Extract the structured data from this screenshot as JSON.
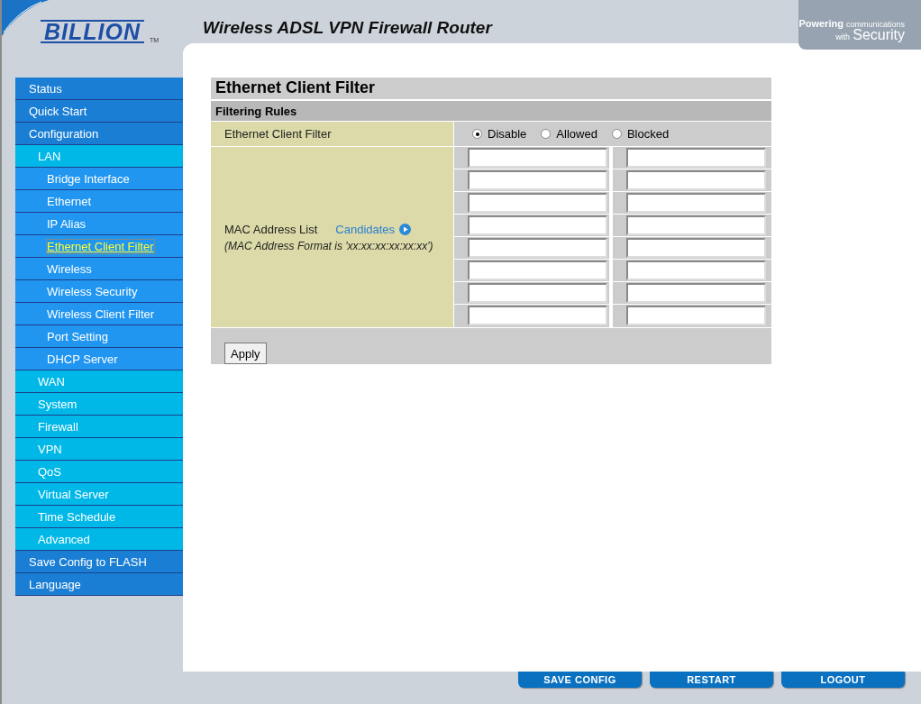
{
  "header": {
    "logo": "BILLION",
    "trademark": "TM",
    "title": "Wireless ADSL VPN Firewall Router",
    "tagline": {
      "lead": "Powering",
      "rest": "communications",
      "line2_small": "with",
      "line2_big": "Security"
    }
  },
  "menu": [
    {
      "label": "Status",
      "selected": false
    },
    {
      "label": "Quick Start",
      "selected": false
    },
    {
      "label": "Configuration",
      "selected": false,
      "children": [
        {
          "label": "LAN",
          "selected": false,
          "children": [
            {
              "label": "Bridge Interface",
              "selected": false
            },
            {
              "label": "Ethernet",
              "selected": false
            },
            {
              "label": "IP Alias",
              "selected": false
            },
            {
              "label": "Ethernet Client Filter",
              "selected": true
            },
            {
              "label": "Wireless",
              "selected": false
            },
            {
              "label": "Wireless Security",
              "selected": false
            },
            {
              "label": "Wireless Client Filter",
              "selected": false
            },
            {
              "label": "Port Setting",
              "selected": false
            },
            {
              "label": "DHCP Server",
              "selected": false
            }
          ]
        },
        {
          "label": "WAN",
          "selected": false
        },
        {
          "label": "System",
          "selected": false
        },
        {
          "label": "Firewall",
          "selected": false
        },
        {
          "label": "VPN",
          "selected": false
        },
        {
          "label": "QoS",
          "selected": false
        },
        {
          "label": "Virtual Server",
          "selected": false
        },
        {
          "label": "Time Schedule",
          "selected": false
        },
        {
          "label": "Advanced",
          "selected": false
        }
      ]
    },
    {
      "label": "Save Config to FLASH",
      "selected": false
    },
    {
      "label": "Language",
      "selected": false
    }
  ],
  "page": {
    "title": "Ethernet Client Filter",
    "section": "Filtering Rules",
    "filter_label": "Ethernet Client Filter",
    "filter_options": [
      {
        "label": "Disable",
        "selected": true
      },
      {
        "label": "Allowed",
        "selected": false
      },
      {
        "label": "Blocked",
        "selected": false
      }
    ],
    "mac_label": "MAC Address List",
    "candidates_link": "Candidates",
    "mac_format_note": "(MAC Address Format is 'xx:xx:xx:xx:xx:xx')",
    "mac_inputs": [
      {
        "disabled": false
      },
      {
        "disabled": false
      },
      {
        "disabled": false
      },
      {
        "disabled": false
      },
      {
        "disabled": false
      },
      {
        "disabled": false
      },
      {
        "disabled": false
      },
      {
        "disabled": false
      },
      {
        "disabled": false
      },
      {
        "disabled": false
      },
      {
        "disabled": false
      },
      {
        "disabled": false
      },
      {
        "disabled": false
      },
      {
        "disabled": false
      },
      {
        "disabled": false
      },
      {
        "disabled": false
      }
    ],
    "apply_button": "Apply"
  },
  "footer_buttons": [
    "SAVE CONFIG",
    "RESTART",
    "LOGOUT"
  ]
}
